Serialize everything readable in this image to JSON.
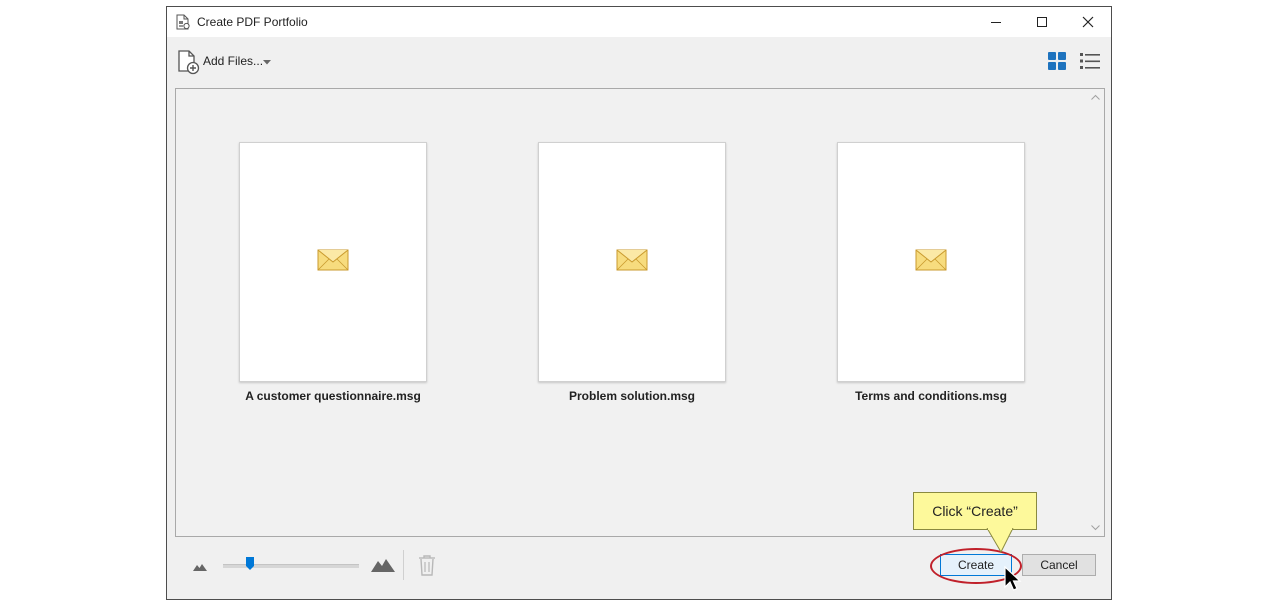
{
  "window": {
    "title": "Create PDF Portfolio"
  },
  "toolbar": {
    "add_files_label": "Add Files..."
  },
  "files": [
    {
      "name": "A customer questionnaire.msg",
      "icon": "envelope-icon"
    },
    {
      "name": "Problem solution.msg",
      "icon": "envelope-icon"
    },
    {
      "name": "Terms and conditions.msg",
      "icon": "envelope-icon"
    }
  ],
  "zoom_slider": {
    "value": 0.2
  },
  "buttons": {
    "create_label": "Create",
    "cancel_label": "Cancel"
  },
  "annotation": {
    "callout_text": "Click “Create”"
  },
  "colors": {
    "accent": "#0078d7",
    "view_icon_active": "#1e73be",
    "callout_bg": "#fdf99b",
    "highlight_ring": "#c0202a"
  }
}
